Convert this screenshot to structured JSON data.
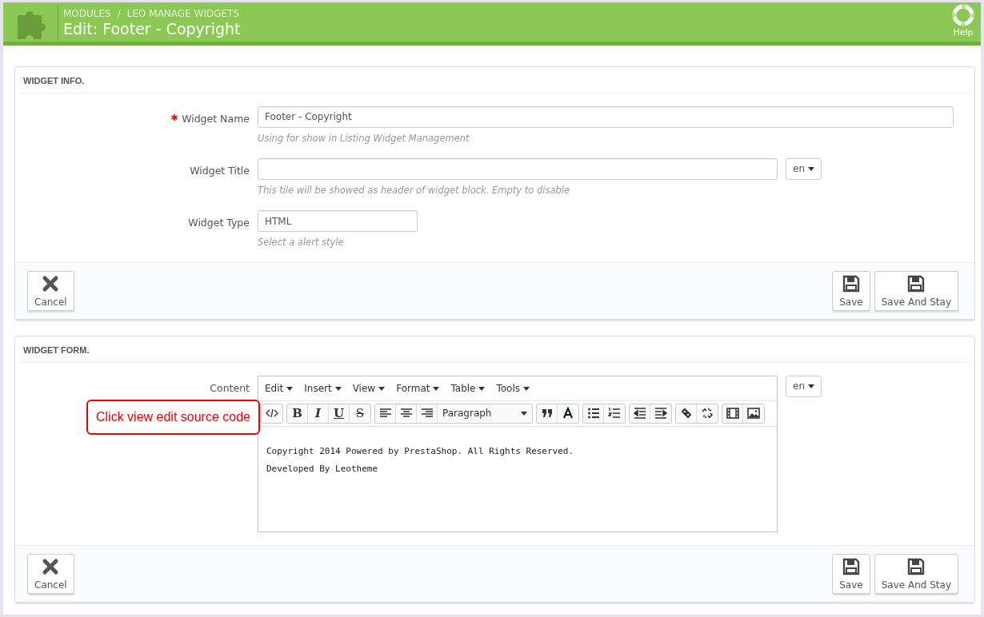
{
  "header": {
    "breadcrumb": [
      "MODULES",
      "LEO MANAGE WIDGETS"
    ],
    "breadcrumb_separator": "/",
    "title": "Edit: Footer - Copyright",
    "help": "Help"
  },
  "info_panel": {
    "heading": "WIDGET INFO.",
    "fields": [
      {
        "kind": "text",
        "label": "Widget Name",
        "required": true,
        "value": "Footer - Copyright",
        "hint": "Using for show in Listing Widget Management"
      },
      {
        "kind": "lang",
        "label": "Widget Title",
        "required": false,
        "lang": "en",
        "hint": "This tile will be showed as header of widget block. Empty to disable"
      },
      {
        "kind": "short",
        "label": "Widget Type",
        "required": false,
        "value": "HTML",
        "hint": "Select a alert style"
      }
    ],
    "buttons": [
      {
        "kind": "cancel",
        "label": "Cancel"
      },
      {
        "kind": "save",
        "label": "Save"
      },
      {
        "kind": "save",
        "label": "Save And Stay"
      }
    ]
  },
  "form_panel": {
    "heading": "WIDGET FORM.",
    "label": "Content",
    "lang": "en",
    "menus": [
      "Edit",
      "Insert",
      "View",
      "Format",
      "Table",
      "Tools"
    ],
    "format_buttons": [
      "B",
      "I",
      "U",
      "S"
    ],
    "block_format": "Paragraph",
    "content": [
      "Copyright 2014 Powered by PrestaShop. All Rights Reserved.",
      "Developed By Leotheme"
    ],
    "callout": "Click view edit source code",
    "buttons": [
      {
        "kind": "cancel",
        "label": "Cancel"
      },
      {
        "kind": "save",
        "label": "Save"
      },
      {
        "kind": "save",
        "label": "Save And Stay"
      }
    ]
  }
}
